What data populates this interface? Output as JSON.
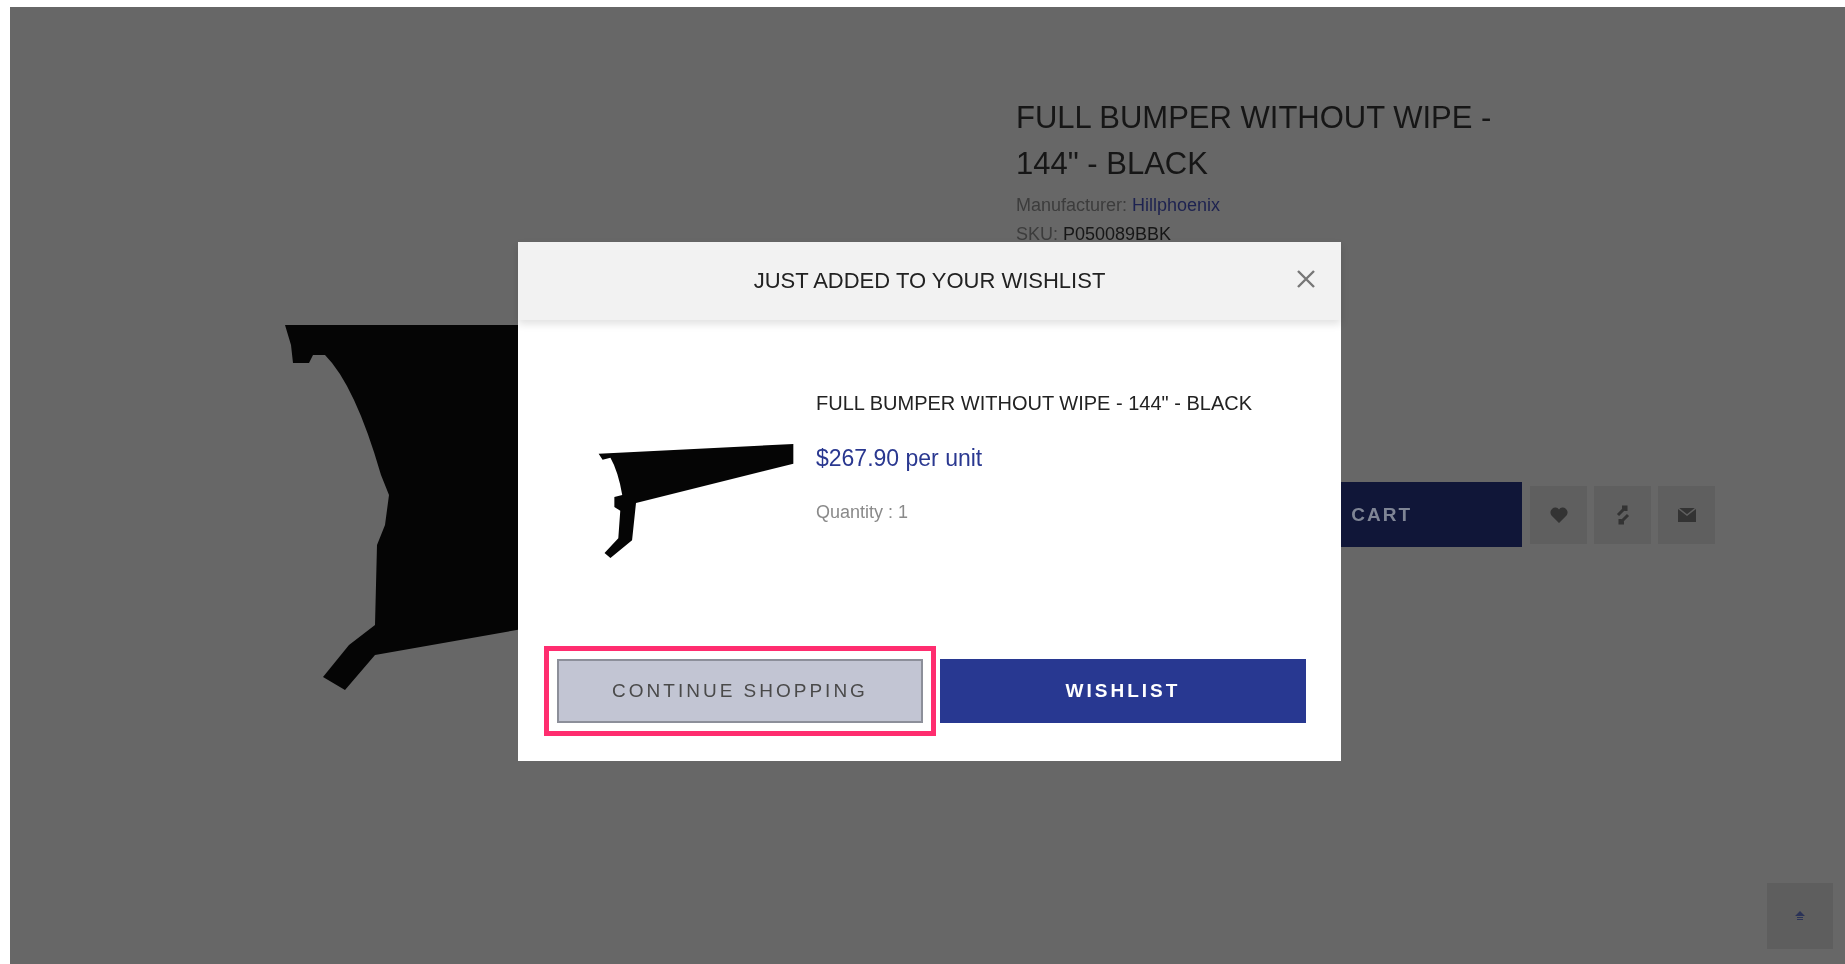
{
  "product": {
    "title": "FULL BUMPER WITHOUT WIPE - 144\" - BLACK",
    "manufacturer_label": "Manufacturer:",
    "manufacturer": "Hillphoenix",
    "sku_label": "SKU:",
    "sku": "P050089BBK",
    "cart_button": "CART"
  },
  "modal": {
    "title": "JUST ADDED TO YOUR WISHLIST",
    "product_name": "FULL BUMPER WITHOUT WIPE - 144\" - BLACK",
    "price": "$267.90 per unit",
    "quantity": "Quantity : 1",
    "buttons": [
      {
        "label": "CONTINUE SHOPPING",
        "kind": "secondary",
        "highlighted": true
      },
      {
        "label": "WISHLIST",
        "kind": "primary",
        "highlighted": false
      }
    ]
  }
}
